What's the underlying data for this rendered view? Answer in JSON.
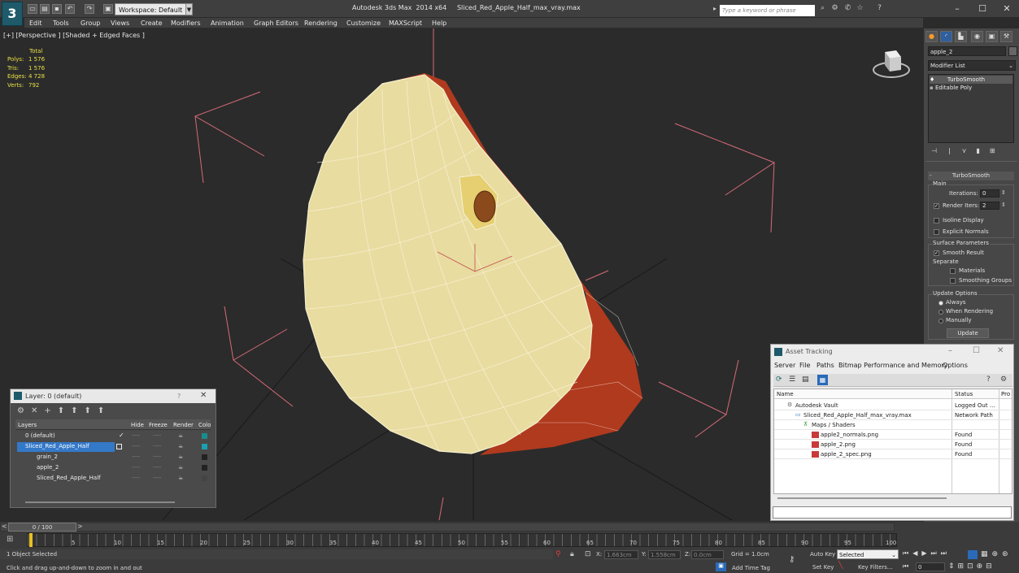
{
  "titlebar": {
    "workspace": "Workspace: Default",
    "app_name": "Autodesk 3ds Max  2014 x64",
    "file_name": "Sliced_Red_Apple_Half_max_vray.max",
    "search_placeholder": "Type a keyword or phrase"
  },
  "menu": [
    "Edit",
    "Tools",
    "Group",
    "Views",
    "Create",
    "Modifiers",
    "Animation",
    "Graph Editors",
    "Rendering",
    "Customize",
    "MAXScript",
    "Help"
  ],
  "viewport": {
    "label": "[+] [Perspective ] [Shaded + Edged Faces ]",
    "stats_header": "Total",
    "stats": [
      {
        "label": "Polys:",
        "value": "1 576"
      },
      {
        "label": "Tris:",
        "value": "1 576"
      },
      {
        "label": "Edges:",
        "value": "4 728"
      },
      {
        "label": "Verts:",
        "value": "792"
      }
    ]
  },
  "command_panel": {
    "object_name": "apple_2",
    "modifier_list": "Modifier List",
    "stack": [
      "TurboSmooth",
      "Editable Poly"
    ],
    "rollout_title": "TurboSmooth",
    "main_group": "Main",
    "iterations_label": "Iterations:",
    "iterations_value": "0",
    "render_iters_label": "Render Iters:",
    "render_iters_value": "2",
    "isoline": "Isoline Display",
    "explicit_normals": "Explicit Normals",
    "surface_group": "Surface Parameters",
    "smooth_result": "Smooth Result",
    "separate": "Separate",
    "materials": "Materials",
    "smoothing_groups": "Smoothing Groups",
    "update_group": "Update Options",
    "always": "Always",
    "when_rendering": "When Rendering",
    "manually": "Manually",
    "update_button": "Update"
  },
  "layer_window": {
    "title": "Layer: 0 (default)",
    "help": "?",
    "columns": [
      "Layers",
      "Hide",
      "Freeze",
      "Render",
      "Colo"
    ],
    "rows": [
      {
        "name": "0 (default)",
        "color": "#1a8c8c",
        "dash": "----"
      },
      {
        "name": "Sliced_Red_Apple_Half",
        "color": "#1aa0b0",
        "dash": "----"
      },
      {
        "name": "grain_2",
        "color": "#222222",
        "dash": "----"
      },
      {
        "name": "apple_2",
        "color": "#222222",
        "dash": "----"
      },
      {
        "name": "Sliced_Red_Apple_Half",
        "color": "#444444",
        "dash": "----"
      }
    ]
  },
  "asset_tracking": {
    "title": "Asset Tracking",
    "menu": [
      "Server",
      "File",
      "Paths",
      "Bitmap Performance and Memory",
      "Options"
    ],
    "columns": [
      "Name",
      "Status",
      "Pro"
    ],
    "rows": [
      {
        "name": "Autodesk Vault",
        "status": "Logged Out ..."
      },
      {
        "name": "Sliced_Red_Apple_Half_max_vray.max",
        "status": "Network Path"
      },
      {
        "name": "Maps / Shaders",
        "status": ""
      },
      {
        "name": "apple2_normals.png",
        "status": "Found"
      },
      {
        "name": "apple_2.png",
        "status": "Found"
      },
      {
        "name": "apple_2_spec.png",
        "status": "Found"
      }
    ]
  },
  "timeline": {
    "frame": "0 / 100",
    "ticks": [
      "5",
      "10",
      "15",
      "20",
      "25",
      "30",
      "35",
      "40",
      "45",
      "50",
      "55",
      "60",
      "65",
      "70",
      "75",
      "80",
      "85",
      "90",
      "95",
      "100"
    ]
  },
  "statusbar": {
    "selected": "1 Object Selected",
    "prompt": "Click and drag up-and-down to zoom in and out",
    "x_label": "X:",
    "x_value": "1.663cm",
    "y_label": "Y:",
    "y_value": "1.558cm",
    "z_label": "Z:",
    "z_value": "0.0cm",
    "grid": "Grid = 1.0cm",
    "add_time_tag": "Add Time Tag",
    "auto_key": "Auto Key",
    "auto_key_value": "Selected",
    "set_key": "Set Key",
    "key_filters": "Key Filters...",
    "frame_value": "0"
  }
}
